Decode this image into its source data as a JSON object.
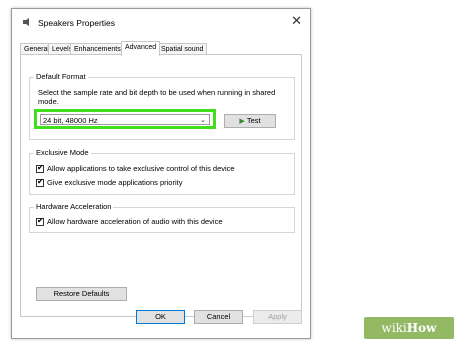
{
  "window": {
    "title": "Speakers Properties",
    "close_glyph": "✕",
    "icon": "speaker-icon"
  },
  "tabs": [
    {
      "label": "General"
    },
    {
      "label": "Levels"
    },
    {
      "label": "Enhancements"
    },
    {
      "label": "Advanced"
    },
    {
      "label": "Spatial sound"
    }
  ],
  "active_tab": "Advanced",
  "default_format": {
    "legend": "Default Format",
    "description": "Select the sample rate and bit depth to be used when running in shared mode.",
    "selected_value": "24 bit, 48000 Hz",
    "test_label": "Test",
    "highlight_color": "#3fe01b"
  },
  "exclusive_mode": {
    "legend": "Exclusive Mode",
    "options": [
      {
        "label": "Allow applications to take exclusive control of this device",
        "checked": true
      },
      {
        "label": "Give exclusive mode applications priority",
        "checked": true
      }
    ]
  },
  "hardware_acceleration": {
    "legend": "Hardware Acceleration",
    "options": [
      {
        "label": "Allow hardware acceleration of audio with this device",
        "checked": true
      }
    ]
  },
  "buttons": {
    "restore_defaults": "Restore Defaults",
    "ok": "OK",
    "cancel": "Cancel",
    "apply": "Apply"
  },
  "watermark": {
    "wiki": "wiki",
    "how": "How",
    "color": "#93b964"
  }
}
